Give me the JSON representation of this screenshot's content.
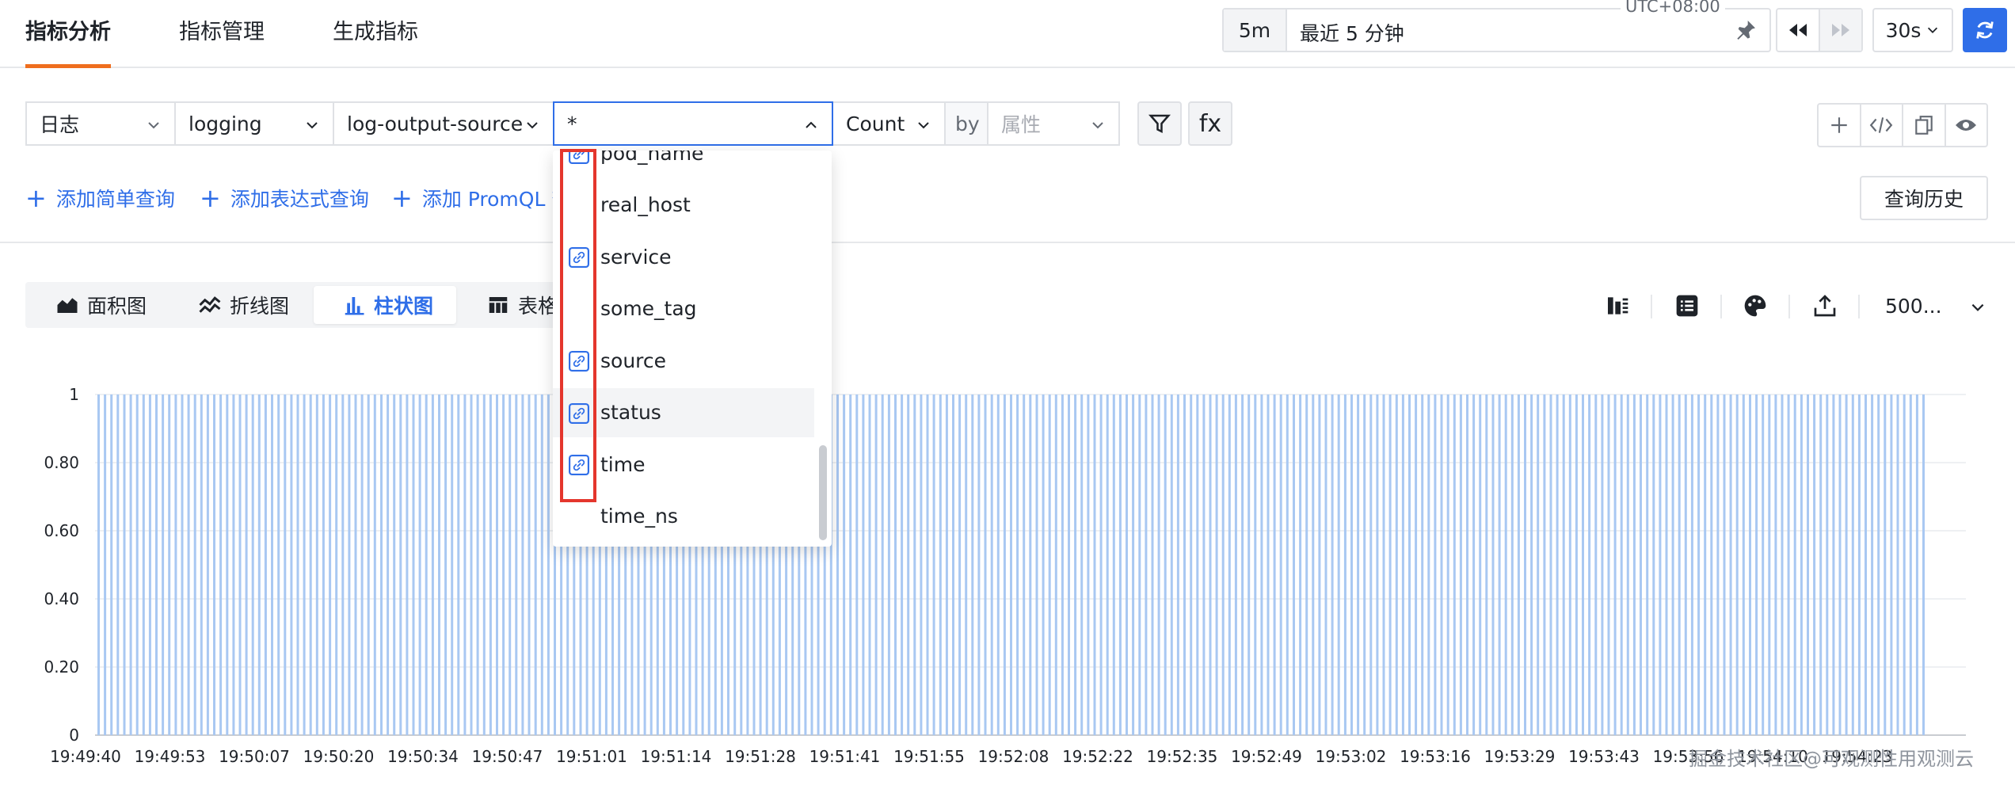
{
  "nav": {
    "tabs": [
      "指标分析",
      "指标管理",
      "生成指标"
    ],
    "active": 0
  },
  "time": {
    "chip": "5m",
    "label": "最近 5 分钟",
    "timezone": "UTC+08:00",
    "refresh_interval": "30s"
  },
  "query": {
    "datasource": "日志",
    "index": "logging",
    "source": "log-output-source",
    "field": "*",
    "agg": "Count",
    "by": "by",
    "attr_placeholder": "属性",
    "fx": "fx"
  },
  "add": {
    "simple": "添加简单查询",
    "expression": "添加表达式查询",
    "promql": "添加 PromQL 查询"
  },
  "history": "查询历史",
  "chart_tabs": [
    "面积图",
    "折线图",
    "柱状图",
    "表格"
  ],
  "active_chart_tab": 2,
  "limit": "500...",
  "dropdown": {
    "options": [
      {
        "label": "pod_name",
        "linked": true
      },
      {
        "label": "real_host",
        "linked": false
      },
      {
        "label": "service",
        "linked": true
      },
      {
        "label": "some_tag",
        "linked": false
      },
      {
        "label": "source",
        "linked": true
      },
      {
        "label": "status",
        "linked": true,
        "hover": true
      },
      {
        "label": "time",
        "linked": true
      },
      {
        "label": "time_ns",
        "linked": false
      }
    ]
  },
  "colors": {
    "accent": "#2f6ee8",
    "tab_underline": "#ef6e1e",
    "highlight": "#e4362d",
    "bar": "#a9c8f2"
  },
  "chart_data": {
    "type": "bar",
    "ylim": [
      0,
      1
    ],
    "yticks": [
      "0",
      "0.20",
      "0.40",
      "0.60",
      "0.80",
      "1"
    ],
    "x_labels": [
      "19:49:40",
      "19:49:53",
      "19:50:07",
      "19:50:20",
      "19:50:34",
      "19:50:47",
      "19:51:01",
      "19:51:14",
      "19:51:28",
      "19:51:41",
      "19:51:55",
      "19:52:08",
      "19:52:22",
      "19:52:35",
      "19:52:49",
      "19:53:02",
      "19:53:16",
      "19:53:29",
      "19:53:43",
      "19:53:56",
      "19:54:10",
      "19:54:23"
    ],
    "bar_count": 285,
    "bar_value": 1,
    "grid": true
  },
  "watermark": "掘金技术社区@可观测性用观测云"
}
